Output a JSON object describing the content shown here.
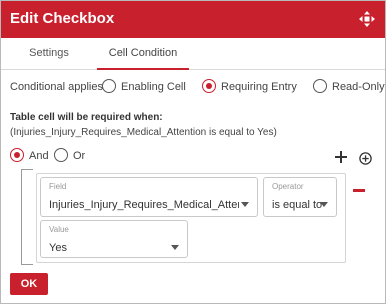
{
  "dialog": {
    "title": "Edit Checkbox",
    "accent_color": "#c8202c",
    "move_icon": "move-arrows-icon"
  },
  "tabs": [
    {
      "label": "Settings",
      "active": false
    },
    {
      "label": "Cell Condition",
      "active": true
    }
  ],
  "applies": {
    "label": "Conditional applies to",
    "options": [
      {
        "label": "Enabling Cell",
        "selected": false
      },
      {
        "label": "Requiring Entry",
        "selected": true
      },
      {
        "label": "Read-Only",
        "selected": false
      }
    ]
  },
  "requirement": {
    "title": "Table cell will be required when:",
    "expression": "(Injuries_Injury_Requires_Medical_Attention is equal to Yes)"
  },
  "logic": {
    "options": [
      {
        "label": "And",
        "selected": true
      },
      {
        "label": "Or",
        "selected": false
      }
    ]
  },
  "condition": {
    "field": {
      "label": "Field",
      "value": "Injuries_Injury_Requires_Medical_Attention"
    },
    "operator": {
      "label": "Operator",
      "value": "is equal to"
    },
    "value": {
      "label": "Value",
      "value": "Yes"
    }
  },
  "footer": {
    "ok_label": "OK"
  }
}
